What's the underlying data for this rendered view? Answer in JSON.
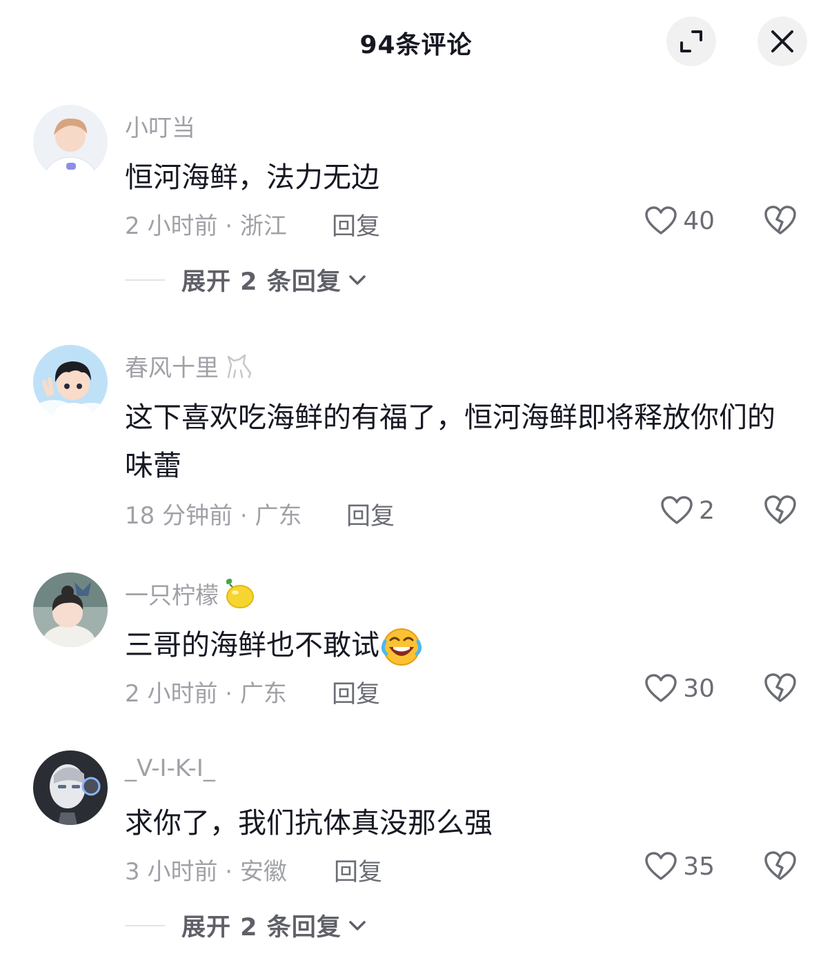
{
  "header": {
    "title": "94条评论"
  },
  "comments": [
    {
      "username": "小叮当",
      "text": "恒河海鲜，法力无边",
      "meta": "2 小时前 · 浙江",
      "reply_label": "回复",
      "likes": "40",
      "expand_label": "展开 2 条回复"
    },
    {
      "username": "春风十里",
      "text": "这下喜欢吃海鲜的有福了，恒河海鲜即将释放你们的味蕾",
      "meta": "18 分钟前 · 广东",
      "reply_label": "回复",
      "likes": "2"
    },
    {
      "username": "一只柠檬",
      "text": "三哥的海鲜也不敢试",
      "meta": "2 小时前 · 广东",
      "reply_label": "回复",
      "likes": "30"
    },
    {
      "username": "_V-I-K-I_",
      "text": "求你了，我们抗体真没那么强",
      "meta": "3 小时前 · 安徽",
      "reply_label": "回复",
      "likes": "35",
      "expand_label": "展开 2 条回复"
    }
  ]
}
